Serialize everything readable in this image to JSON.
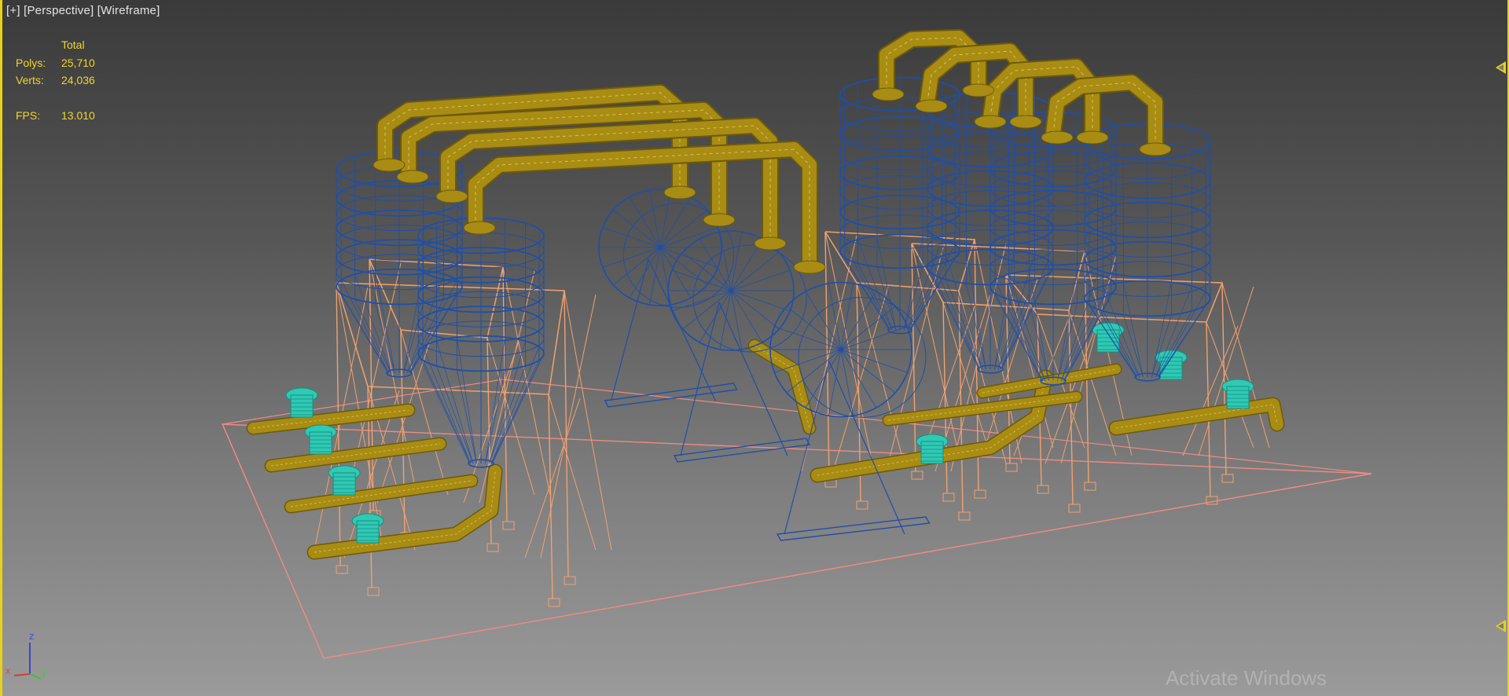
{
  "viewport": {
    "labels": [
      "[+]",
      "[Perspective]",
      "[Wireframe]"
    ],
    "colors": {
      "background_top": "#3a3a3a",
      "background_bottom": "#9a9a9a",
      "active_border": "#e6d21c",
      "blue_wire": "#1f4fa8",
      "gold_pipe": "#a88c14",
      "orange_frame": "#f2a16e",
      "teal_valve": "#2fc9b4",
      "ground_outline": "#f08a82",
      "stats_text": "#f0d62a"
    }
  },
  "stats": {
    "header": "Total",
    "polys_label": "Polys:",
    "polys_value": "25,710",
    "verts_label": "Verts:",
    "verts_value": "24,036",
    "fps_label": "FPS:",
    "fps_value": "13.010"
  },
  "axis_gizmo": {
    "x": "x",
    "y": "y",
    "z": "z"
  },
  "watermark": "Activate Windows"
}
